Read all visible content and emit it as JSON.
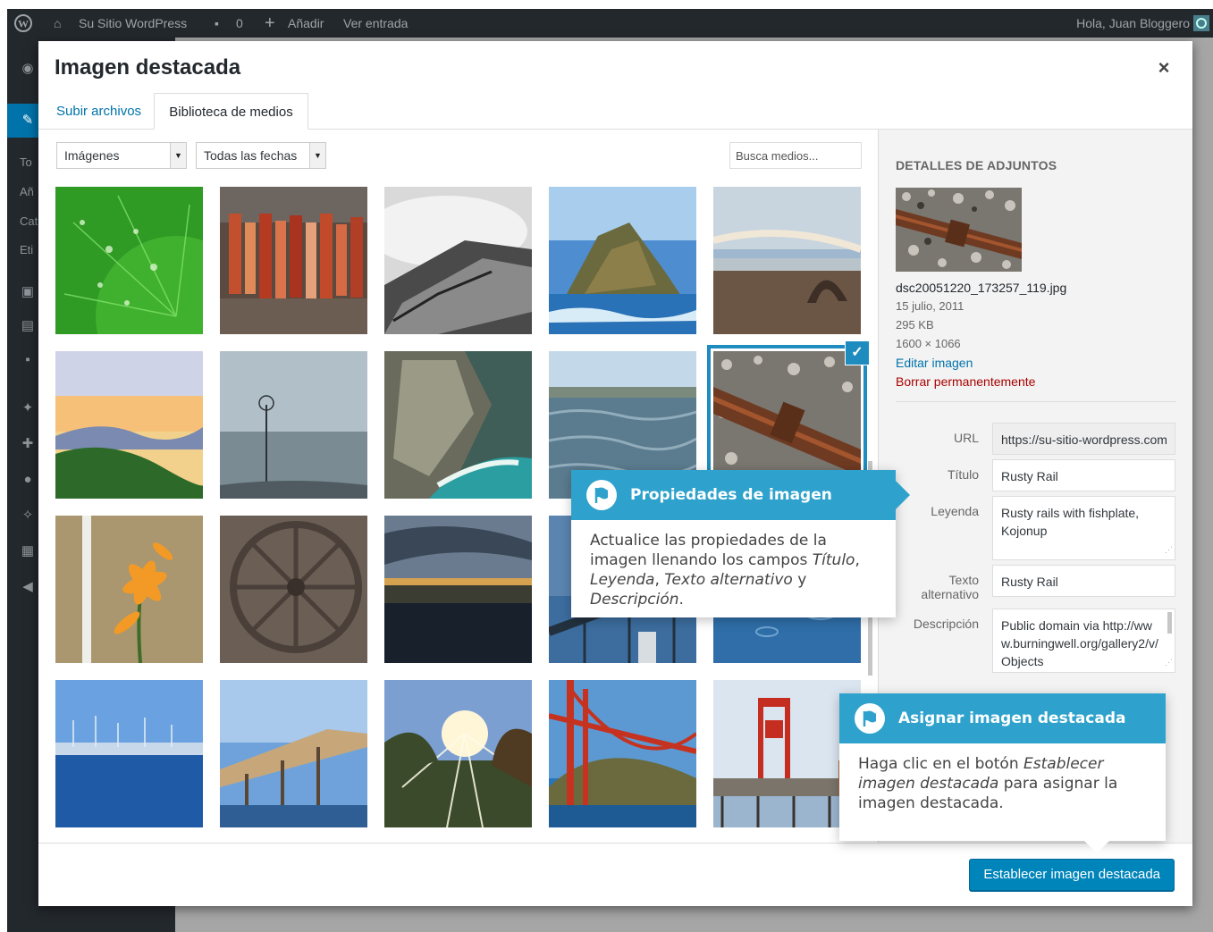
{
  "admin_bar": {
    "site_name": "Su Sitio WordPress",
    "comments_count": "0",
    "add_new": "Añadir",
    "view_post": "Ver entrada",
    "greeting": "Hola, Juan Bloggero"
  },
  "admin_menu": {
    "visible_fragments": [
      "To",
      "Añ",
      "Cat",
      "Eti"
    ]
  },
  "modal": {
    "title": "Imagen destacada",
    "close_label": "×",
    "tabs": [
      {
        "label": "Subir archivos",
        "active": false
      },
      {
        "label": "Biblioteca de medios",
        "active": true
      }
    ],
    "filters": {
      "type": "Imágenes",
      "date": "Todas las fechas",
      "search_placeholder": "Busca medios..."
    },
    "grid": {
      "selected_index": 9,
      "thumbnails": [
        {
          "subject": "green leaf with water drops"
        },
        {
          "subject": "rusty peeling metal"
        },
        {
          "subject": "black and white rock"
        },
        {
          "subject": "rocky sea coast"
        },
        {
          "subject": "beach rock arch"
        },
        {
          "subject": "sunset over hills"
        },
        {
          "subject": "windmill in fog"
        },
        {
          "subject": "cove with cliffs"
        },
        {
          "subject": "shallow sea water"
        },
        {
          "subject": "rusty rail with fishplate"
        },
        {
          "subject": "orange lily"
        },
        {
          "subject": "old iron wheels"
        },
        {
          "subject": "dusk over water"
        },
        {
          "subject": "bridge at night"
        },
        {
          "subject": "rain on water"
        },
        {
          "subject": "blue harbour"
        },
        {
          "subject": "wooden pier"
        },
        {
          "subject": "sunlight through trees"
        },
        {
          "subject": "golden gate bridge"
        },
        {
          "subject": "red tower on pier"
        }
      ]
    },
    "details": {
      "heading": "DETALLES DE ADJUNTOS",
      "filename": "dsc20051220_173257_119.jpg",
      "date": "15 julio, 2011",
      "filesize": "295 KB",
      "dimensions": "1600 × 1066",
      "edit_link": "Editar imagen",
      "delete_link": "Borrar permanentemente",
      "fields": {
        "url_label": "URL",
        "url_value": "https://su-sitio-wordpress.com",
        "title_label": "Título",
        "title_value": "Rusty Rail",
        "caption_label": "Leyenda",
        "caption_value": "Rusty rails with fishplate, Kojonup",
        "alt_label_1": "Texto",
        "alt_label_2": "alternativo",
        "alt_value": "Rusty Rail",
        "description_label": "Descripción",
        "description_value": "Public domain via http://www.burningwell.org/gallery2/v/Objects"
      }
    },
    "footer": {
      "button_label": "Establecer imagen destacada"
    }
  },
  "pointers": {
    "properties": {
      "title": "Propiedades de imagen",
      "body_lead": "Actualice las propiedades de la imagen llenando los campos ",
      "body_em1": "Título",
      "body_sep1": ", ",
      "body_em2": "Leyenda",
      "body_sep2": ", ",
      "body_em3": "Texto alternativo",
      "body_sep3": " y ",
      "body_em4": "Descripción",
      "body_end": "."
    },
    "assign": {
      "title": "Asignar imagen destacada",
      "body_lead": "Haga clic en el botón ",
      "body_em": "Establecer imagen destacada",
      "body_end": " para asignar la imagen destacada."
    }
  },
  "colors": {
    "accent": "#0073aa",
    "pointer_head": "#2ea2cc",
    "primary_button": "#0085ba",
    "delete": "#aa0000",
    "admin_bar": "#23282d"
  }
}
